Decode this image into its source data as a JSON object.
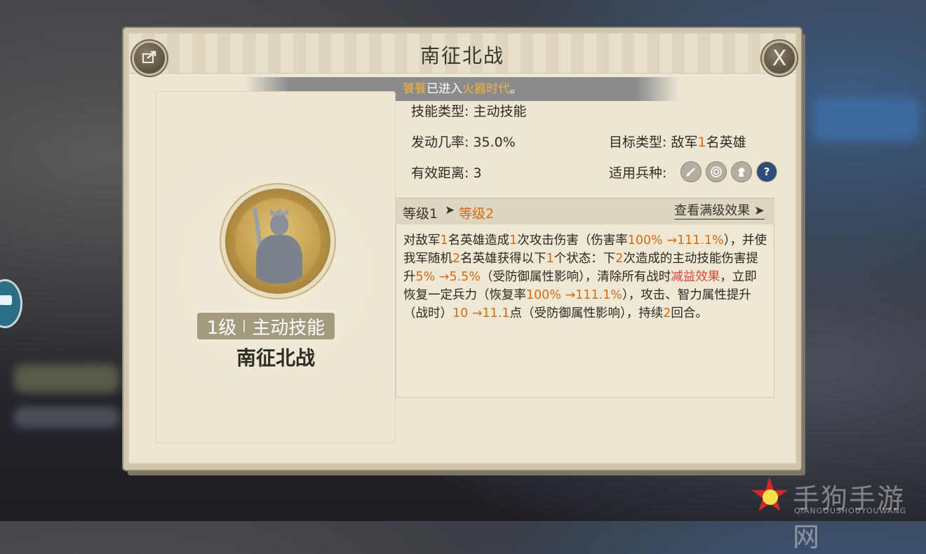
{
  "dialog": {
    "title": "南征北战",
    "share_icon": "share-icon",
    "close_label": "X"
  },
  "banner": {
    "player": "饕餮",
    "mid": "已进入",
    "era": "火器时代",
    "end": "。"
  },
  "skill": {
    "level_num": "1级",
    "skill_type_tag": "主动技能",
    "name": "南征北战"
  },
  "info": {
    "type_label": "技能类型:",
    "type_value": "主动技能",
    "rate_label": "发动几率:",
    "rate_value": "35.0%",
    "target_label": "目标类型:",
    "target_prefix": "敌军",
    "target_num": "1",
    "target_suffix": "名英雄",
    "range_label": "有效距离:",
    "range_value": "3",
    "troop_label": "适用兵种:",
    "troops": [
      "sword-icon",
      "target-icon",
      "horse-icon",
      "question-icon"
    ]
  },
  "levels": {
    "current": "等级1",
    "arrow": "➤",
    "next": "等级2",
    "full_effect": "查看满级效果",
    "full_arrow": "➤"
  },
  "description": {
    "s1": "对敌军",
    "n1": "1",
    "s2": "名英雄造成",
    "n2": "1",
    "s3": "次攻击伤害（伤害率",
    "n3": "100% →111.1%",
    "s4": "），并使我军随机",
    "n4": "2",
    "s5": "名英雄获得以下",
    "n5": "1",
    "s6": "个状态：下",
    "n6": "2",
    "s7": "次造成的主动技能伤害提升",
    "n7": "5% →5.5%",
    "s8": "（受防御属性影响），清除所有战时",
    "r1": "减益效果",
    "s9": "，立即恢复一定兵力（恢复率",
    "n8": "100% →111.1%",
    "s10": "），攻击、智力属性提升（战时）",
    "n9": "10 →11.1",
    "s11": "点（受防御属性影响），持续",
    "n10": "2",
    "s12": "回合。"
  },
  "watermark": {
    "text": "手狗手游网",
    "sub": "QIANGOUSHOUYOUWANG"
  }
}
